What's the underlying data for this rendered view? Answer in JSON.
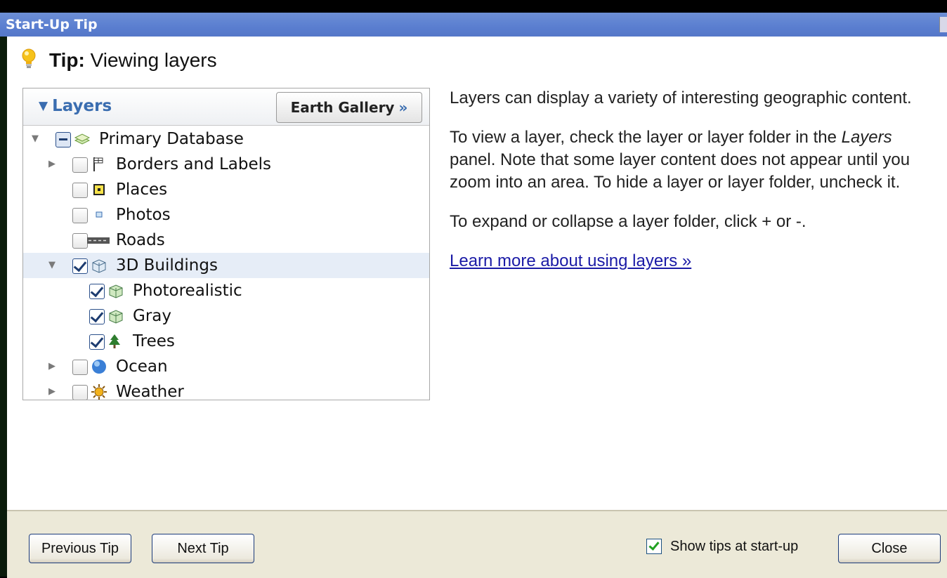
{
  "window": {
    "title": "Start-Up Tip"
  },
  "tip": {
    "prefix": "Tip:",
    "title": "Viewing layers"
  },
  "layers_panel": {
    "title": "Layers",
    "gallery_button": "Earth Gallery",
    "gallery_chevron": "»",
    "items": [
      {
        "label": "Primary Database",
        "icon": "database-icon",
        "state": "partial",
        "expander": "expanded"
      },
      {
        "label": "Borders and Labels",
        "icon": "flag-icon",
        "state": "unchecked",
        "expander": "collapsed"
      },
      {
        "label": "Places",
        "icon": "places-icon",
        "state": "unchecked",
        "expander": "none"
      },
      {
        "label": "Photos",
        "icon": "photo-icon",
        "state": "unchecked",
        "expander": "none"
      },
      {
        "label": "Roads",
        "icon": "road-icon",
        "state": "unchecked",
        "expander": "none"
      },
      {
        "label": "3D Buildings",
        "icon": "building-icon",
        "state": "checked",
        "expander": "expanded",
        "selected": true
      },
      {
        "label": "Photorealistic",
        "icon": "building-icon",
        "state": "checked",
        "expander": "none"
      },
      {
        "label": "Gray",
        "icon": "building-icon",
        "state": "checked",
        "expander": "none"
      },
      {
        "label": "Trees",
        "icon": "tree-icon",
        "state": "checked",
        "expander": "none"
      },
      {
        "label": "Ocean",
        "icon": "globe-icon",
        "state": "unchecked",
        "expander": "collapsed"
      },
      {
        "label": "Weather",
        "icon": "sun-icon",
        "state": "unchecked",
        "expander": "collapsed"
      }
    ]
  },
  "description": {
    "para1": "Layers can display a variety of interesting geographic content.",
    "para2_pre": "To view a layer, check the layer or layer folder in the ",
    "para2_em": "Layers",
    "para2_post": " panel. Note that some layer content does not appear until you zoom into an area. To hide a layer or layer folder, uncheck it.",
    "para3": "To expand or collapse a layer folder, click + or -.",
    "link": "Learn more about using layers »"
  },
  "footer": {
    "previous": "Previous Tip",
    "next": "Next Tip",
    "show_tips": "Show tips at start-up",
    "show_tips_checked": true,
    "close": "Close"
  },
  "colors": {
    "title_bar": "#5a7ed0",
    "accent": "#3a6db0",
    "footer_bg": "#ece9d8",
    "link": "#1a1aa6"
  }
}
